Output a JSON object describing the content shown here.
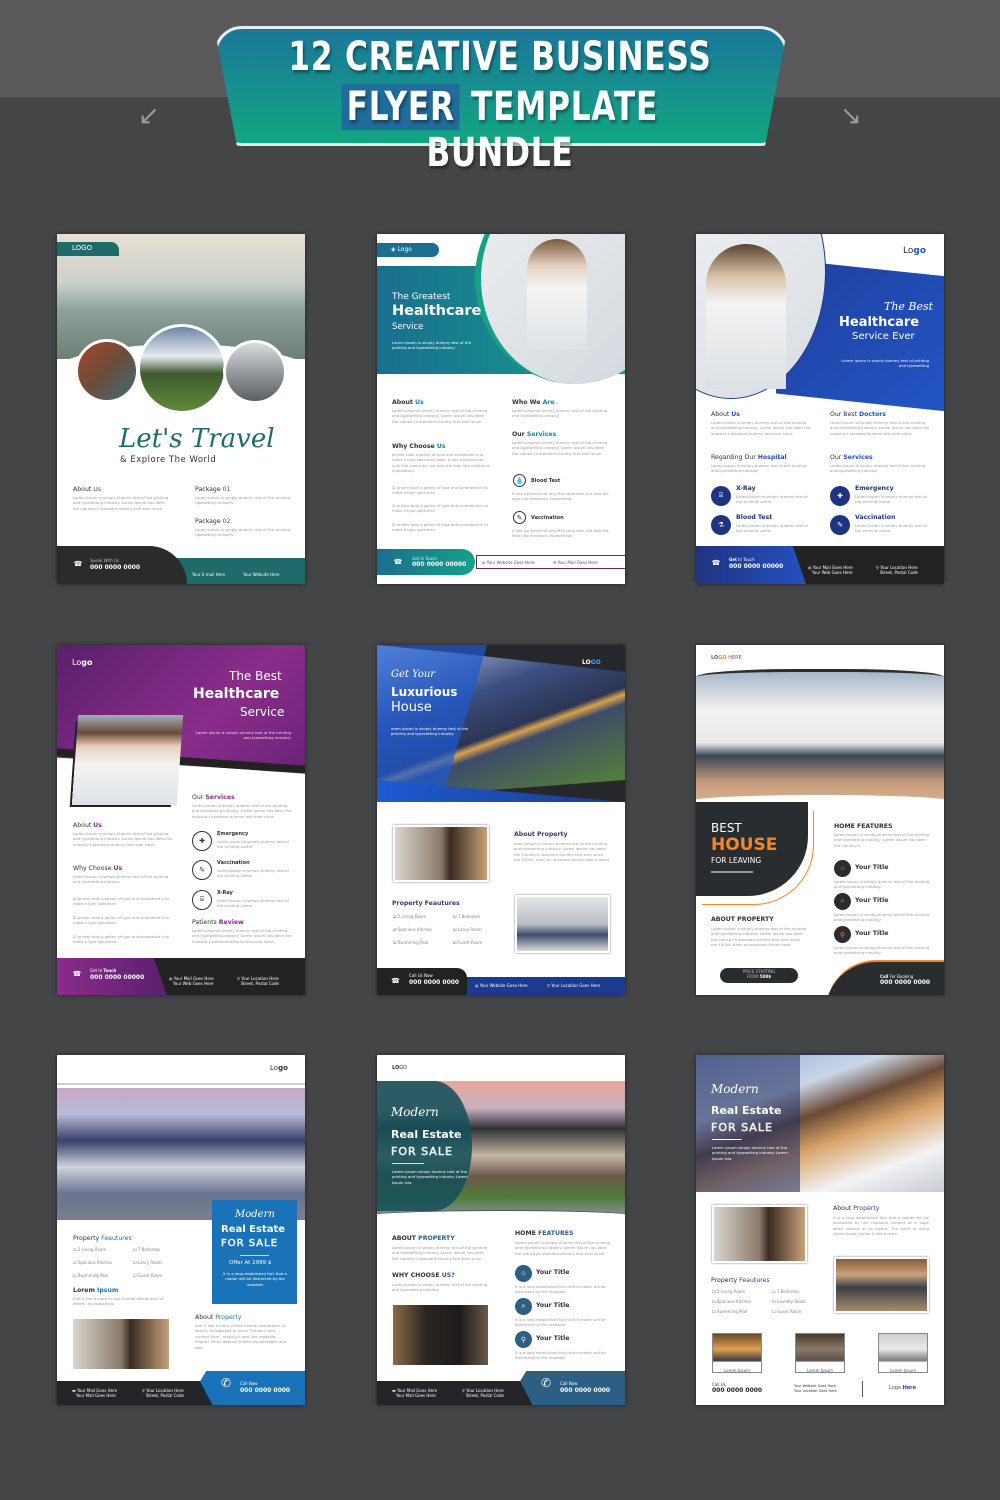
{
  "banner": {
    "line1": "12 CREATIVE BUSINESS",
    "line2_highlight": "FLYER",
    "line2_rest": "TEMPLATE BUNDLE",
    "colors": [
      "#1b779a",
      "#12a682"
    ]
  },
  "lorem": {
    "a": "Lorem Ipsum is simply dummy text of the printing and typesetting industry. Lorem Ipsum has been the industry's standard dummy text ever since",
    "b": "Lorem Ipsum is simply dummy text of the printing typesetting industry.",
    "c": "Lorem Ipsum is simply dummy text of the printing and typesetting industry.",
    "d": "printer took a galley of type and scrambled it to make a type specimen",
    "e": "Lorem Ipsum is simply dummy text of the printing Lorem",
    "f": "It has survived not only five centuries, but also the leap into electronic typesetting.",
    "g": "It is a long established fact that a reader will be distracted by the readable",
    "h": "that it has a more-or-less normal distribution of letters, as opposed to"
  },
  "f1": {
    "logo": "LOGO",
    "title": "Let's Travel",
    "subtitle": "& Explore The World",
    "about": "About ",
    "about_hl": "Us",
    "pkg1": "Package ",
    "pkg1_hl": "01",
    "pkg2": "Package ",
    "pkg2_hl": "02",
    "speak": "Speak With Us",
    "phone": "000 0000 0000",
    "email": "Your E-mail Here",
    "web": "Your Website Here"
  },
  "f2": {
    "logo": "Logo",
    "t1": "The Greatest",
    "t2": "Healthcare",
    "t3": "Service",
    "intro": "Lorem Ipsum is simply dummy test of the printing and typesetting industry.",
    "about": "About ",
    "hl_us": "Us",
    "why": "Why Choose ",
    "why_p": "printer took a galley of type and scrambled it to make a type specimen book. It has survived not only five centuries, but also the leap into electronic typesetting.",
    "who": "Who We ",
    "who_hl": "Are",
    "our": "Our ",
    "services": "Services",
    "blood": "Blood Test",
    "vacc": "Vaccination",
    "git": "Get In Touch",
    "phone": "000 0000 00000",
    "web": "Your Website Goes Here",
    "mail": "Your Mail Goes Here"
  },
  "f3": {
    "logo_a": "Lo",
    "logo_b": "go",
    "t1": "The Best",
    "t2": "Healthcare",
    "t3": "Service Ever",
    "intro": "Lorem Ipsum is simply dummy test of printing and typesetting",
    "about": "About ",
    "us": "Us",
    "best": "Our Best ",
    "doctors": "Doctors",
    "reg": "Regarding Our ",
    "hospital": "Hospital",
    "our": "Our ",
    "services": "Services",
    "xray": "X-Ray",
    "emergency": "Emergency",
    "blood": "Blood Test",
    "vacc": "Vaccination",
    "get": "Get",
    "intouch": " In Touch",
    "phone": "000 0000 00000",
    "mail": "Your Mail Goes Here",
    "webg": "Your Web Goes Here",
    "loc": "Your Location Here",
    "postal": "Street, Postal Code"
  },
  "f4": {
    "logo_a": "Lo",
    "logo_b": "go",
    "t1": "The Best",
    "t2": "Healthcare",
    "t3": "Service",
    "intro": "Lorem Ipsum is simply dummy text of the printing and typesetting industry.",
    "our": "Our ",
    "services": "Services",
    "about": "About ",
    "us": "Us",
    "why": "Why Choose ",
    "emergency": "Emergency",
    "vacc": "Vaccination",
    "xray": "X-Ray",
    "patients": "Patients ",
    "review": "Review",
    "get": "Get In ",
    "touch": "Touch",
    "phone": "000 0000 00000",
    "mail": "Your Mail Goes Here",
    "webg": "Your Web Goes Here",
    "loc": "Your Location Here",
    "postal": "Street, Postal Code"
  },
  "f5": {
    "logo_a": "LO",
    "logo_b": "GO",
    "t1": "Get Your",
    "t2": "Luxurious",
    "t3": "House",
    "intro": "orem Ipsum is simply dummy text of the printing and typesetting industry.",
    "about": "About Property",
    "about_p": "orem Ipsum is simply dummy text of the printing and typesetting industry. Lorem Ipsum has been the industry's standard dummy text ever since the 1500s, when an unknown printer took a galley",
    "feat": "Property Feautures",
    "items": [
      "2 Living Room",
      "7 Bedroom",
      "Spacious Kitchen",
      "Lanry Room",
      "Swimming Pool",
      "Guest Room"
    ],
    "call": "Call Us Now",
    "phone": "000 0000 0000",
    "web": "Your Website Goes Here",
    "loc": "Your Location Goes Here"
  },
  "f6": {
    "logo_a": "LO",
    "logo_b": "GO",
    "logo_c": " HERE",
    "best": "BEST",
    "house": "HOUSE",
    "leaving": "FOR LEAVING",
    "home": "HOME FEATURES",
    "home_p": "Lorem Ipsum is simply dummy text of the printing and typesetting industry. Lorem Ipsum has been the industry's",
    "title": "Your Title",
    "about": "ABOUT PROPERTY",
    "about_p": "Lorem Ipsum is simply dummy text of the printing and typesetting industry. Lorem Ipsum has been the industry's standard dummy text ever since the 1500s, when an unknown printer took",
    "price1": "PRICE STARTING",
    "price2": "FROM ",
    "price_val": "500$",
    "call": "Call",
    "booking": " For Booking",
    "phone": "000 0000 0000",
    "accent": "#f7862a"
  },
  "f7": {
    "logo_a": "Lo",
    "logo_b": "go",
    "modern": "Modern",
    "re": "Real Estate",
    "sale": "FOR SALE",
    "offer": "Offer At  2999 $",
    "offer_p": "It is a long established fact that a reader will be distracted by the readable",
    "feat": "Property ",
    "feat_hl": "Feautures",
    "items": [
      "2 Living Room",
      "7 Bedroom",
      "Spacious Kitchen",
      "Lanry Room",
      "Swimming Pool",
      "Guest Room"
    ],
    "lorem": "Lorem ",
    "ipsum": "Ipsum",
    "about": "About ",
    "property": "Property",
    "about_p": "that it has a more-or-less normal distribution of letters, as opposed to using 'Content here, content here', making it look like readable English. Many desktop publishing packages and web",
    "mail": "Your Mail Goes Here",
    "loc": "Your Location Here",
    "postal": "Street, Postal Code",
    "callnow": "Call Now",
    "phone": "000 0000 0000"
  },
  "f8": {
    "logo_a": "LO",
    "logo_b": "GO",
    "modern": "Modern",
    "re": "Real Estate",
    "sale": "FOR SALE",
    "intro": "Lorem Ipsum simply dummy text of the printing and typesetting industry Lorem Ipsum has",
    "about": "ABOUT ",
    "property": "PROPERTY",
    "home": "HOME ",
    "features": "FEATURES",
    "why": "WHY CHOOSE ",
    "us": "US?",
    "title": "Your Title",
    "mail": "Your Mail Goes Here",
    "loc": "Your Location Here",
    "postal": "Street, Postal Code",
    "callnow": "Call Now",
    "phone": "000 0000 0000"
  },
  "f9": {
    "modern": "Modern",
    "re": "Real Estate",
    "sale": "FOR SALE",
    "intro": "Lorem Ipsum simply dummy text of the printing and typesetting industry Lorem Ipsum has",
    "about": "About ",
    "property": "Property",
    "about_p": "It is a long established fact that a reader will be distracted by the readable content of a page when looking at its layout. The point of using Lorem Ipsum is that it has a more",
    "feat": "Property ",
    "feat_hl": "Feautures",
    "items": [
      "2 Living Room",
      "7 Bedroom",
      "Spacious Kitchen",
      "Laundry Room",
      "Swimming Pool",
      "Guest Room"
    ],
    "thumb": "Lorem Ipsum",
    "callus": "Call Us",
    "phone": "000 0000 0000",
    "web": "Your Website Goes Here",
    "loc": "Your Location Goes Here",
    "logo": "Logo ",
    "here": "Here"
  }
}
